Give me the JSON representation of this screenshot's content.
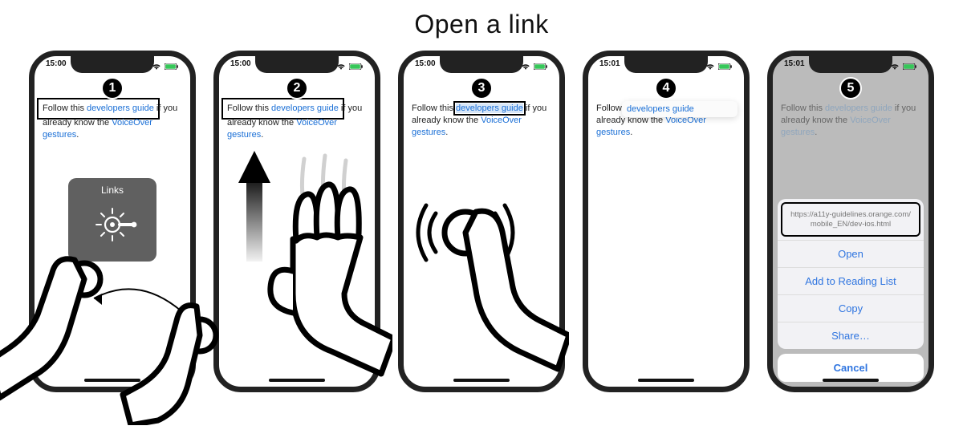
{
  "title": "Open a link",
  "status": {
    "time_a": "15:00",
    "time_b": "15:01"
  },
  "text": {
    "prefix": "Follow this ",
    "link1": "developers guide",
    "mid": " if you already know the ",
    "link2": "VoiceOver gestures",
    "suffix": "."
  },
  "rotor_label": "Links",
  "step4_tooltip": "developers guide",
  "action_sheet": {
    "url_line1": "https://a11y-guidelines.orange.com/",
    "url_line2": "mobile_EN/dev-ios.html",
    "open": "Open",
    "add": "Add to Reading List",
    "copy": "Copy",
    "share": "Share…",
    "cancel": "Cancel"
  },
  "steps": [
    "1",
    "2",
    "3",
    "4",
    "5"
  ]
}
